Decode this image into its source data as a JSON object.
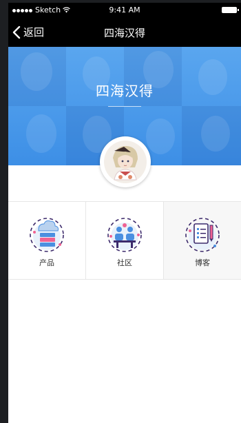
{
  "status_bar": {
    "carrier": "Sketch",
    "time": "9:41 AM"
  },
  "nav": {
    "back_label": "返回",
    "title": "四海汉得"
  },
  "banner": {
    "title": "四海汉得"
  },
  "grid": {
    "items": [
      {
        "label": "产品",
        "icon": "product-icon"
      },
      {
        "label": "社区",
        "icon": "community-icon"
      },
      {
        "label": "博客",
        "icon": "blog-icon"
      }
    ]
  },
  "colors": {
    "banner": "#4a9aea",
    "accent_pink": "#f06292",
    "accent_blue": "#4a8fe0",
    "dark_purple": "#3c2a6b"
  }
}
